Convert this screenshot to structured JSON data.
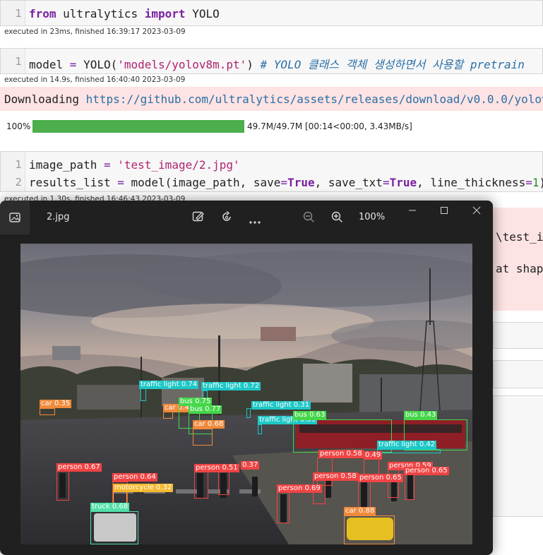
{
  "cells": [
    {
      "line_numbers": [
        "1"
      ],
      "status": "executed in 23ms, finished 16:39:17 2023-03-09"
    },
    {
      "line_numbers": [
        "1"
      ],
      "status": "executed in 14.9s, finished 16:40:40 2023-03-09"
    },
    {
      "line_numbers": [
        "1",
        "2"
      ],
      "status": "executed in 1.30s, finished 16:46:43 2023-03-09"
    }
  ],
  "code": {
    "c1": {
      "from": "from",
      "module": " ultralytics ",
      "import": "import",
      "name": " YOLO"
    },
    "c2": {
      "var": "model ",
      "eq": "=",
      "call": " YOLO(",
      "arg": "'models/yolov8m.pt'",
      "close": ") ",
      "comment": "# YOLO 클래스 객체 생성하면서 사용할 pretrain"
    },
    "c3a": {
      "var": "image_path ",
      "eq": "=",
      "space": " ",
      "str": "'test_image/2.jpg'"
    },
    "c3b": {
      "pre": "results_list ",
      "eq": "=",
      "call": " model(image_path, save",
      "eq2": "=",
      "t1": "True",
      "mid": ", save_txt",
      "eq3": "=",
      "t2": "True",
      "mid2": ", line_thickness",
      "eq4": "=",
      "n1": "1",
      "tail": ")#"
    }
  },
  "download": {
    "prefix": "Downloading ",
    "url": "https://github.com/ultralytics/assets/releases/download/v0.0.0/yolov",
    "percent": "100%",
    "progress": 1.0,
    "stats": "49.7M/49.7M [00:14<00:00, 3.43MB/s]"
  },
  "output_fragments": {
    "path": "\\test_i",
    "shape": "at shap"
  },
  "viewer": {
    "filename": "2.jpg",
    "zoom": "100%",
    "icons": [
      "gallery-icon",
      "edit-image-icon",
      "rotate-icon",
      "more-icon",
      "zoom-out-icon",
      "zoom-in-icon",
      "minimize-icon",
      "maximize-icon",
      "close-icon"
    ]
  },
  "detections": [
    {
      "label": "traffic light 0.74",
      "color": "#1ec7c7"
    },
    {
      "label": "traffic light 0.72",
      "color": "#1ec7c7"
    },
    {
      "label": "car 0.35",
      "color": "#f08a3c"
    },
    {
      "label": "car 0.4",
      "color": "#f08a3c"
    },
    {
      "label": "bus 0.75",
      "color": "#46d64a"
    },
    {
      "label": "bus 0.77",
      "color": "#46d64a"
    },
    {
      "label": "car 0.68",
      "color": "#f08a3c"
    },
    {
      "label": "traffic light 0.31",
      "color": "#1ec7c7"
    },
    {
      "label": "traffic light 0.39",
      "color": "#1ec7c7"
    },
    {
      "label": "bus 0.63",
      "color": "#46d64a"
    },
    {
      "label": "bus 0.43",
      "color": "#46d64a"
    },
    {
      "label": "traffic light 0.42",
      "color": "#1ec7c7"
    },
    {
      "label": "person 0.58",
      "color": "#f04444"
    },
    {
      "label": "0.49",
      "color": "#f04444"
    },
    {
      "label": "person 0.67",
      "color": "#f04444"
    },
    {
      "label": "person 0.64",
      "color": "#f04444"
    },
    {
      "label": "motorcycle 0.32",
      "color": "#f5b82e"
    },
    {
      "label": "person 0.51",
      "color": "#f04444"
    },
    {
      "label": "0.37",
      "color": "#f04444"
    },
    {
      "label": "person 0.59",
      "color": "#f04444"
    },
    {
      "label": "person 0.65",
      "color": "#f04444"
    },
    {
      "label": "person 0.58",
      "color": "#f04444"
    },
    {
      "label": "person 0.65",
      "color": "#f04444"
    },
    {
      "label": "person 0.69",
      "color": "#f04444"
    },
    {
      "label": "truck 0.68",
      "color": "#52e0a8"
    },
    {
      "label": "car 0.88",
      "color": "#f08a3c"
    }
  ]
}
